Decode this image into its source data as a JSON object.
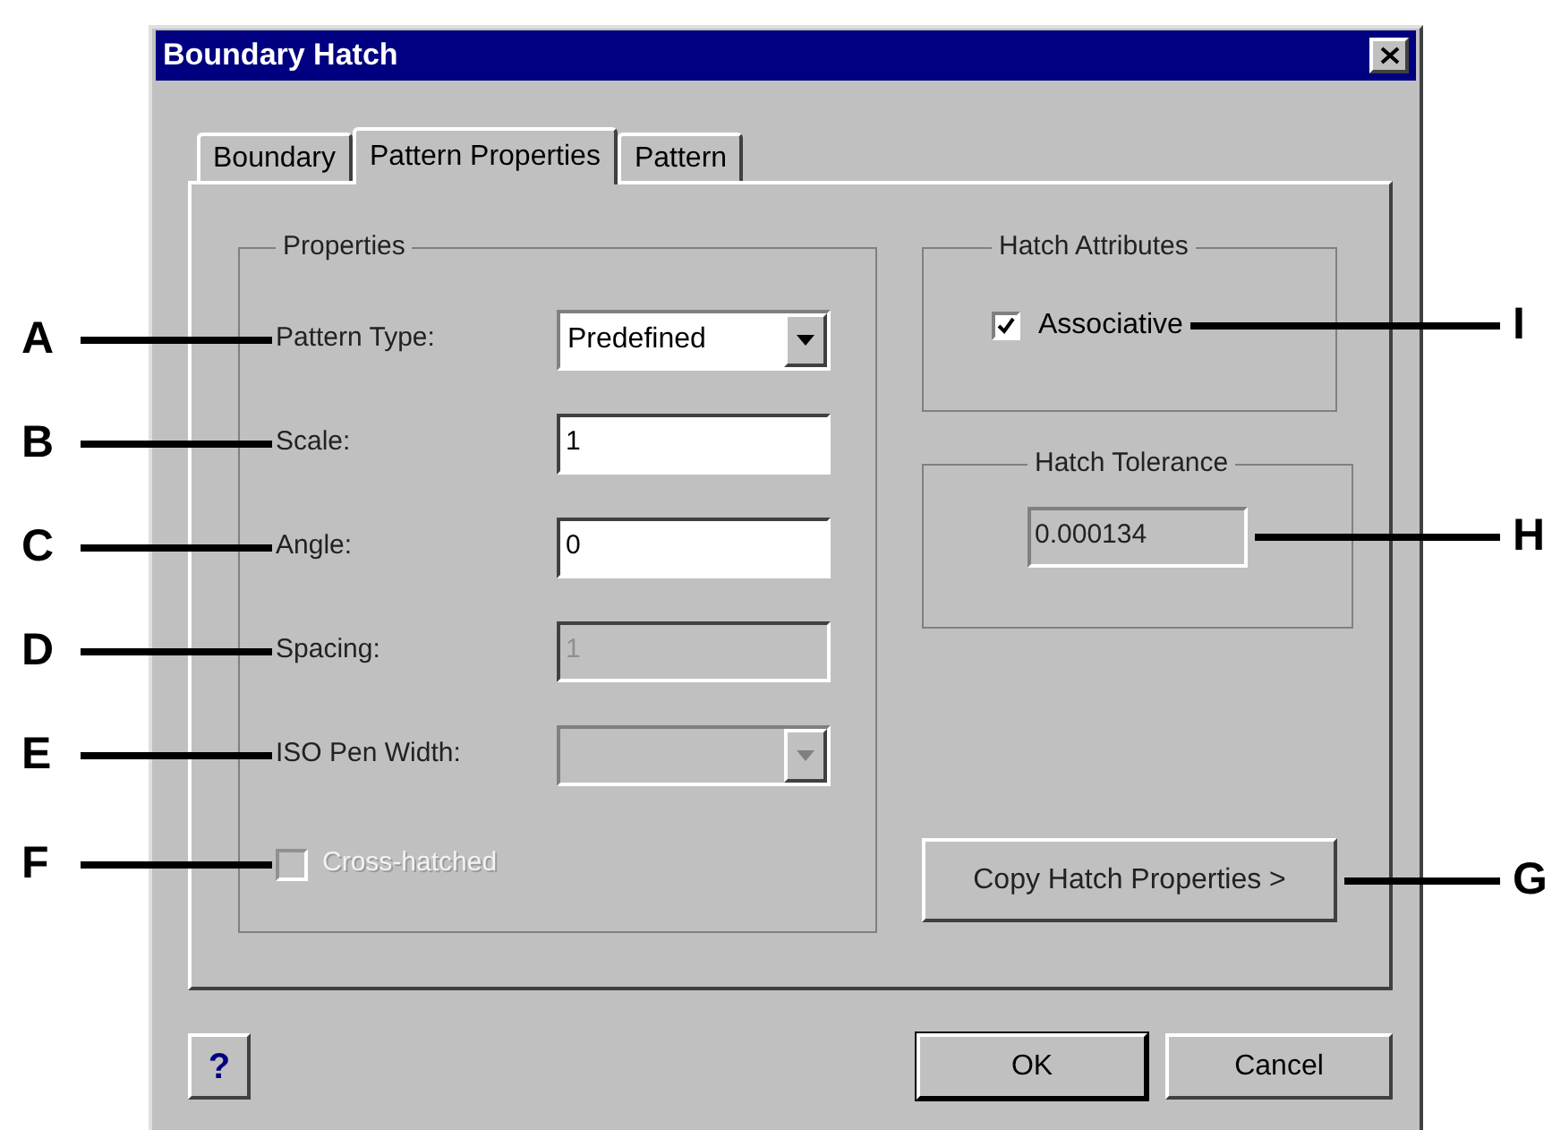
{
  "window": {
    "title": "Boundary Hatch"
  },
  "tabs": [
    {
      "label": "Boundary",
      "selected": false
    },
    {
      "label": "Pattern Properties",
      "selected": true
    },
    {
      "label": "Pattern",
      "selected": false
    }
  ],
  "properties": {
    "title": "Properties",
    "fields": [
      {
        "kind": "dropdown",
        "label": "Pattern Type:",
        "value": "Predefined",
        "disabled": false,
        "callout": "A"
      },
      {
        "kind": "text",
        "label": "Scale:",
        "value": "1",
        "disabled": false,
        "callout": "B"
      },
      {
        "kind": "text",
        "label": "Angle:",
        "value": "0",
        "disabled": false,
        "callout": "C"
      },
      {
        "kind": "text",
        "label": "Spacing:",
        "value": "1",
        "disabled": true,
        "callout": "D"
      },
      {
        "kind": "dropdown",
        "label": "ISO Pen Width:",
        "disabled": true,
        "callout": "E"
      }
    ],
    "cross_hatched": {
      "label": "Cross-hatched",
      "checked": false,
      "disabled": true,
      "callout": "F"
    }
  },
  "hatch_attributes": {
    "title": "Hatch Attributes",
    "associative": {
      "label": "Associative",
      "checked": true,
      "callout": "I"
    }
  },
  "hatch_tolerance": {
    "title": "Hatch Tolerance",
    "value": "0.000134",
    "callout": "H"
  },
  "copy_button": {
    "label": "Copy Hatch Properties >",
    "callout": "G"
  },
  "buttons": [
    {
      "kind": "help",
      "label": "?"
    },
    {
      "kind": "ok",
      "label": "OK"
    },
    {
      "kind": "cancel",
      "label": "Cancel"
    }
  ]
}
